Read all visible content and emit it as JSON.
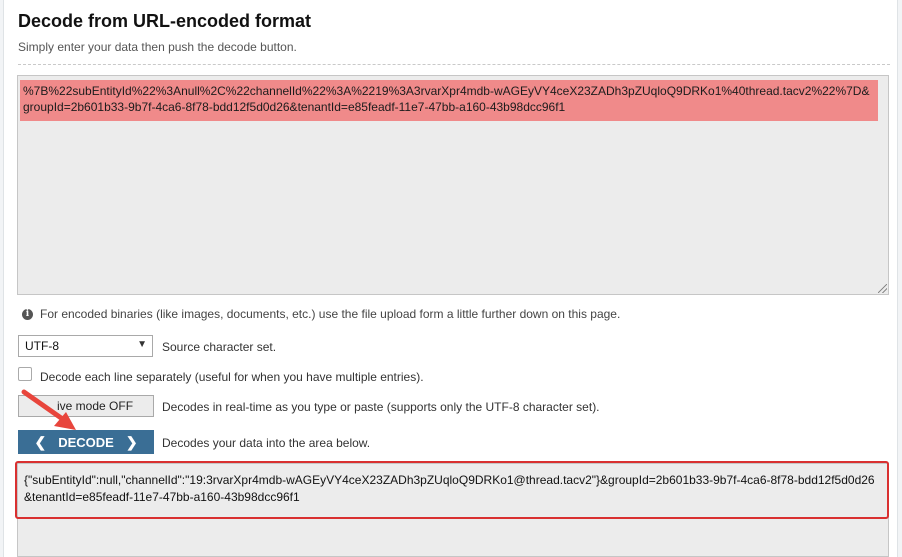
{
  "header": {
    "title": "Decode from URL-encoded format",
    "subtitle": "Simply enter your data then push the decode button."
  },
  "input": {
    "value": "%7B%22subEntityId%22%3Anull%2C%22channelId%22%3A%2219%3A3rvarXpr4mdb-wAGEyVY4ceX23ZADh3pZUqloQ9DRKo1%40thread.tacv2%22%7D&groupId=2b601b33-9b7f-4ca6-8f78-bdd12f5d0d26&tenantId=e85feadf-11e7-47bb-a160-43b98dcc96f1"
  },
  "info": {
    "text": "For encoded binaries (like images, documents, etc.) use the file upload form a little further down on this page.",
    "icon": "info-icon"
  },
  "charset": {
    "selected": "UTF-8",
    "label": "Source character set."
  },
  "options": {
    "decode_each_line_label": "Decode each line separately (useful for when you have multiple entries).",
    "decode_each_line_checked": false,
    "live_mode_label": "Live mode OFF",
    "live_mode_visible": "ive mode OFF",
    "live_mode_desc": "Decodes in real-time as you type or paste (supports only the UTF-8 character set)."
  },
  "decode": {
    "label": "DECODE",
    "desc": "Decodes your data into the area below."
  },
  "output": {
    "value": "{\"subEntityId\":null,\"channelId\":\"19:3rvarXpr4mdb-wAGEyVY4ceX23ZADh3pZUqloQ9DRKo1@thread.tacv2\"}&groupId=2b601b33-9b7f-4ca6-8f78-bdd12f5d0d26&tenantId=e85feadf-11e7-47bb-a160-43b98dcc96f1"
  },
  "colors": {
    "accent": "#3a6e95",
    "input_highlight": "#f08a8a",
    "annotation_red": "#d93030"
  }
}
